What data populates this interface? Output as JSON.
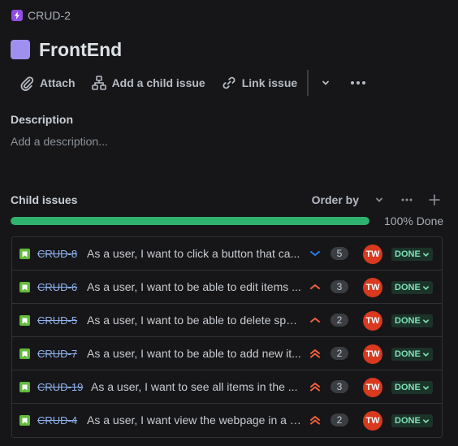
{
  "breadcrumb": {
    "parent_key": "CRUD-2"
  },
  "issue": {
    "title": "FrontEnd"
  },
  "toolbar": {
    "attach_label": "Attach",
    "add_child_label": "Add a child issue",
    "link_label": "Link issue"
  },
  "description": {
    "label": "Description",
    "placeholder": "Add a description..."
  },
  "child_issues": {
    "label": "Child issues",
    "order_by_label": "Order by",
    "progress_percent": 100,
    "progress_text": "100% Done",
    "items": [
      {
        "key": "CRUD-8",
        "summary": "As a user, I want to click a button that ca...",
        "priority": "low",
        "points": "5",
        "assignee": "TW",
        "status": "DONE"
      },
      {
        "key": "CRUD-6",
        "summary": "As a user, I want to be able to edit items ...",
        "priority": "medium",
        "points": "3",
        "assignee": "TW",
        "status": "DONE"
      },
      {
        "key": "CRUD-5",
        "summary": "As a user, I want to be able to delete spe...",
        "priority": "medium",
        "points": "2",
        "assignee": "TW",
        "status": "DONE"
      },
      {
        "key": "CRUD-7",
        "summary": "As a user, I want to be able to add new it...",
        "priority": "high",
        "points": "2",
        "assignee": "TW",
        "status": "DONE"
      },
      {
        "key": "CRUD-19",
        "summary": "As a user, I want to see all items in the ...",
        "priority": "high",
        "points": "3",
        "assignee": "TW",
        "status": "DONE"
      },
      {
        "key": "CRUD-4",
        "summary": "As a user, I want view the webpage in a c...",
        "priority": "high",
        "points": "2",
        "assignee": "TW",
        "status": "DONE"
      }
    ]
  },
  "colors": {
    "background": "#161618",
    "epic_badge": "#904ee2",
    "issue_type_square": "#9f8fef",
    "progress_done": "#2fb26e",
    "story_icon": "#63ba3c",
    "avatar": "#d8391f",
    "status_done_bg": "#1c3329",
    "status_done_text": "#7ee2b8",
    "priority_low": "#2b7de9",
    "priority_medium_high": "#f0623e"
  },
  "icons": {
    "breadcrumb": "lightning-bolt-icon",
    "attach": "paperclip-icon",
    "add_child": "hierarchy-icon",
    "link": "link-icon",
    "more": "more-horizontal-icon",
    "dropdown": "chevron-down-icon",
    "add": "plus-icon",
    "story": "bookmark-icon",
    "priority_low": "chevron-down-icon",
    "priority_medium": "chevron-up-icon",
    "priority_high": "double-chevron-up-icon"
  }
}
